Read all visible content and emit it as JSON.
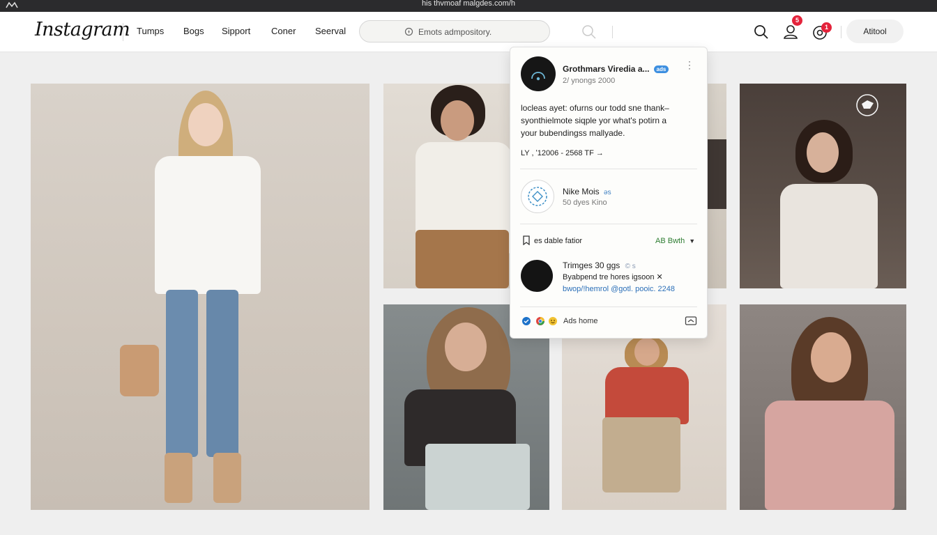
{
  "window": {
    "title": "his thvmoaf malgdes.com/h"
  },
  "header": {
    "logo": "Instagram",
    "nav": [
      "Tumps",
      "Bogs",
      "Sipport",
      "Coner",
      "Seerval"
    ],
    "search_placeholder": "Emots admpository.",
    "notification_badges": [
      "5",
      "1"
    ],
    "account_label": "Atitool"
  },
  "popup": {
    "post": {
      "name": "Grothmars Viredia a...",
      "badge": "ads",
      "date": "2/ ynongs 2000",
      "caption": [
        "locleas ayet: ofurns our todd sne thank–",
        "syonthielmote siqple yor what's potirn a",
        "your bubendingss mallyade."
      ],
      "stats": "LY , ʹ12006 - 2568 TF →"
    },
    "account": {
      "name": "Nike Mois",
      "tag": "ǝs",
      "meta": "50 dyes Kino"
    },
    "section": {
      "title": "es dable fatior",
      "action": "AB Bwth"
    },
    "item": {
      "title": "Trimges 30 ggs",
      "tag": "© s",
      "line1": "Byabpend tre hores igsoon ✕",
      "line2": "bwop/!hemrol @gotl. pooic. 2248"
    },
    "footer": {
      "label": "Ads home"
    }
  },
  "colors": {
    "brand_badge": "#e4233b",
    "link_blue": "#2b6fb8",
    "action_green": "#2e7d32"
  }
}
